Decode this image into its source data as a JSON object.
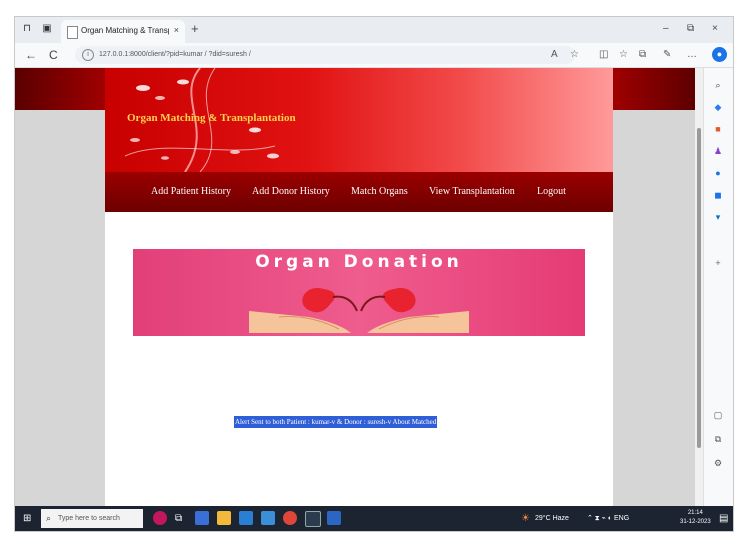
{
  "browser": {
    "tab_title": "Organ Matching & Transplantation",
    "tab_close": "×",
    "new_tab": "+",
    "url": "127.0.0.1:8000/client/?pid=kumar / ?did=suresh /",
    "window_controls": [
      "–",
      "⧉",
      "×"
    ],
    "nav": {
      "back": "←",
      "refresh": "C"
    }
  },
  "site": {
    "title": "Organ Matching & Transplantation",
    "nav_items": [
      "Add Patient History",
      "Add Donor History",
      "Match Organs",
      "View Transplantation",
      "Logout"
    ],
    "banner_title": "Organ Donation",
    "match_message": "Alert Sent to both Patient : kumar-v & Donor : suresh-v About Matched"
  },
  "taskbar": {
    "search_placeholder": "Type here to search",
    "weather": "29°C Haze",
    "time": "21:14",
    "date": "31-12-2023"
  },
  "colors": {
    "header_red": "#e11212",
    "nav_dark_red": "#7a0000",
    "title_gold": "#ffd24a",
    "banner_pink": "#ef5c8e",
    "selection_blue": "#2f5fd6"
  }
}
